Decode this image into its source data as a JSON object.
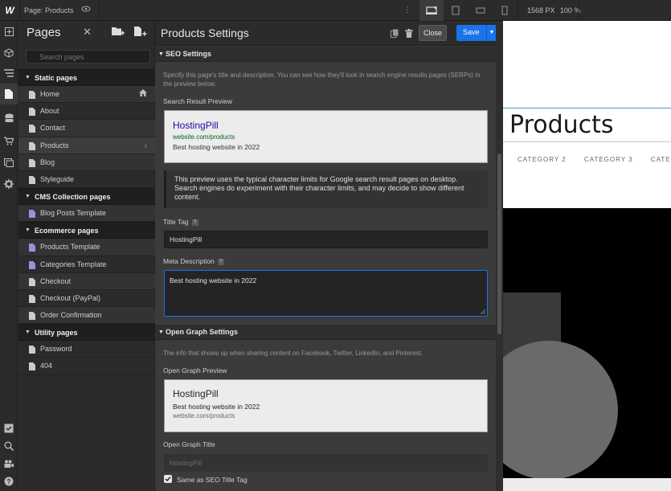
{
  "topbar": {
    "page_label": "Page: Products",
    "width_readout": "1568 PX",
    "zoom_readout": "100 %"
  },
  "pages_panel": {
    "title": "Pages",
    "search_placeholder": "Search pages",
    "groups": [
      {
        "label": "Static pages",
        "items": [
          "Home",
          "About",
          "Contact",
          "Products",
          "Blog",
          "Styleguide"
        ]
      },
      {
        "label": "CMS Collection pages",
        "items": [
          "Blog Posts Template"
        ]
      },
      {
        "label": "Ecommerce pages",
        "items": [
          "Products Template",
          "Categories Template",
          "Checkout",
          "Checkout (PayPal)",
          "Order Confirmation"
        ]
      },
      {
        "label": "Utility pages",
        "items": [
          "Password",
          "404"
        ]
      }
    ]
  },
  "settings": {
    "title": "Products Settings",
    "close_label": "Close",
    "save_label": "Save",
    "seo": {
      "header": "SEO Settings",
      "description": "Specify this page's title and description. You can see how they'll look in search engine results pages (SERPs) in the preview below.",
      "preview_label": "Search Result Preview",
      "preview_title": "HostingPill",
      "preview_url": "website.com/products",
      "preview_desc": "Best hosting website in 2022",
      "notice": "This preview uses the typical character limits for Google search result pages on desktop. Search engines do experiment with their character limits, and may decide to show different content.",
      "title_tag_label": "Title Tag",
      "title_tag_value": "HostingPill",
      "meta_label": "Meta Description",
      "meta_value": "Best hosting website in 2022"
    },
    "og": {
      "header": "Open Graph Settings",
      "description": "The info that shows up when sharing content on Facebook, Twitter, LinkedIn, and Pinterest.",
      "preview_label": "Open Graph Preview",
      "preview_title": "HostingPill",
      "preview_desc": "Best hosting website in 2022",
      "preview_url": "website.com/products",
      "og_title_label": "Open Graph Title",
      "og_title_value": "HostingPill",
      "same_as_label": "Same as SEO Title Tag"
    }
  },
  "canvas": {
    "heading": "Products",
    "categories": [
      "CATEGORY 2",
      "CATEGORY 3",
      "CATEGO"
    ]
  },
  "colors": {
    "accent": "#1a73e8",
    "panel_bg": "#3b3b3b",
    "serp_link": "#1a0dab",
    "serp_url": "#006621"
  }
}
